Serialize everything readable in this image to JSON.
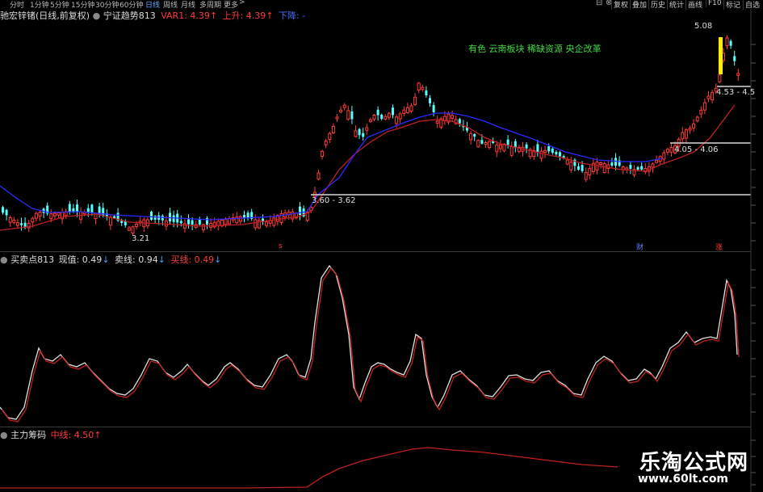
{
  "toolbar": {
    "periods": [
      "分时",
      "1分钟",
      "5分钟",
      "15分钟",
      "30分钟",
      "60分钟",
      "日线",
      "周线",
      "月线",
      "多周期",
      "更多"
    ],
    "active_period": "日线",
    "buttons": [
      "复权",
      "叠加",
      "历史",
      "统计",
      "画线",
      "F10",
      "标记",
      "自选"
    ],
    "controls": {
      "restore": "⊟",
      "close": "⊗"
    }
  },
  "main_panel": {
    "stock_title": "驰宏锌锗(日线,前复权)",
    "indicator_name": "宁证趋势813",
    "var1_label": "VAR1: 4.39",
    "var1_arrow": "↑",
    "up_label": "上升: 4.39",
    "up_arrow": "↑",
    "down_label": "下降: -",
    "concepts": "有色  云南板块  稀缺资源  央企改革",
    "price_labels": {
      "high": "5.08",
      "low": "3.21",
      "range1": "3.60 - 3.62",
      "range2": "4.05 - 4.06",
      "range3": "4.53 - 4.5"
    },
    "markers": {
      "s_marker": "s",
      "cai_marker": "财",
      "zhang_marker": "涨"
    }
  },
  "mid_panel": {
    "indicator_name": "买卖点813",
    "now_label": "现值: 0.49",
    "now_arrow": "↓",
    "sell_label": "卖线: 0.94",
    "sell_arrow": "↓",
    "buy_label": "买线: 0.49",
    "buy_arrow": "↓"
  },
  "bottom_panel": {
    "indicator_name": "主力筹码",
    "mid_label": "中线: 4.50",
    "mid_arrow": "↑"
  },
  "watermark": {
    "title": "乐淘公式网",
    "url": "www.60lt.com"
  },
  "colors": {
    "up_candle": "#ff3b3b",
    "down_candle": "#54ffff",
    "ma_red": "#c02020",
    "ma_blue": "#2a2aff",
    "indicator_white": "#e0e0e0",
    "indicator_red": "#c02020",
    "highlight_yellow": "#ffee00",
    "concept_green": "#3fdc3f"
  }
}
